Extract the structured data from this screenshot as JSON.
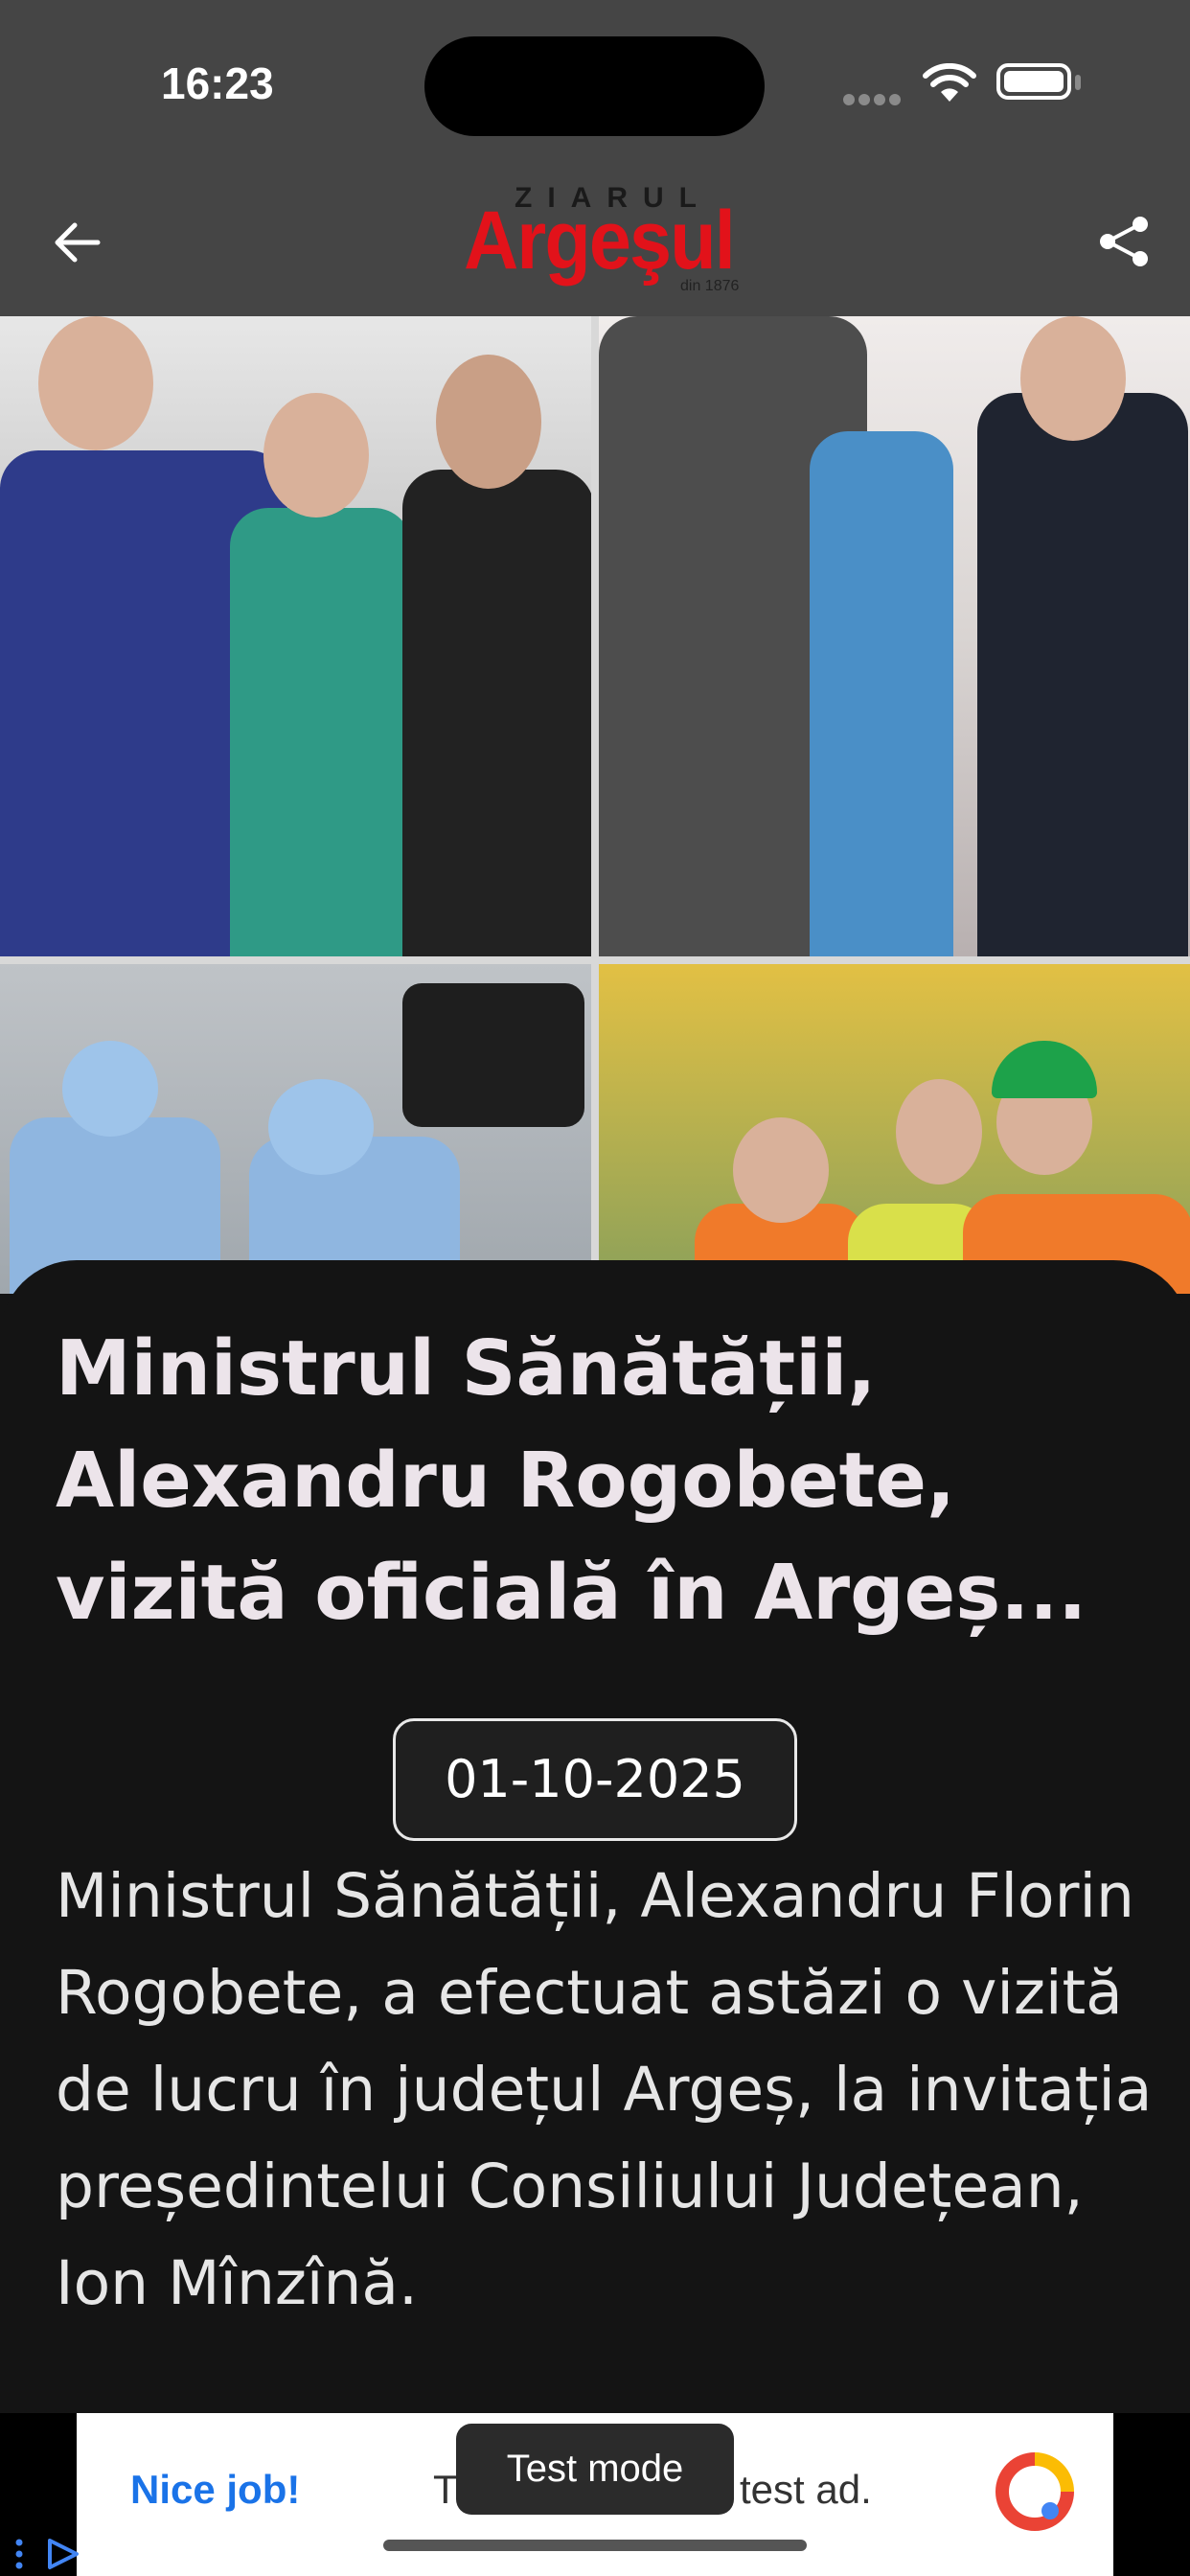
{
  "status_bar": {
    "time": "16:23"
  },
  "header": {
    "logo_top": "ZIARUL",
    "logo_main": "Argeşul",
    "logo_sub": "din 1876",
    "back_icon": "arrow-left-icon",
    "share_icon": "share-icon"
  },
  "article": {
    "title": "Ministrul Sănătății, Alexandru Rogobete, vizită oficială în Argeș...",
    "date": "01-10-2025",
    "body": "Ministrul Sănătății, Alexandru Florin Rogobete, a efectuat astăzi o vizită de lucru în județul Argeș, la invitația președintelui Consiliului Județean, Ion Mînzînă."
  },
  "ad": {
    "nice_job": "Nice job!",
    "text_pre": "T",
    "text_post": "test ad.",
    "toast": "Test mode"
  },
  "colors": {
    "brand_red": "#e2121a",
    "header_bg": "#454545",
    "card_bg": "#141414",
    "ad_link": "#1a73e8"
  }
}
